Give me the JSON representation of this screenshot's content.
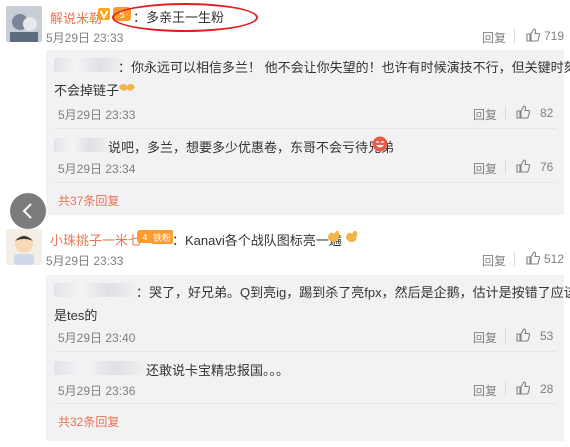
{
  "comments": [
    {
      "username": "解说米勒",
      "text": "：多亲王一生粉",
      "time": "5月29日 23:33",
      "reply_label": "回复",
      "likes": "719",
      "subreplies": [
        {
          "text": "：你永远可以相信多兰！ 他不会让你失望的！也许有时候演技不行，但关键时刻绝",
          "text2": "不会掉链子",
          "time": "5月29日 23:33",
          "reply_label": "回复",
          "likes": "82"
        },
        {
          "text": "说吧，多兰，想要多少优惠卷，东哥不会亏待兄弟",
          "time": "5月29日 23:34",
          "reply_label": "回复",
          "likes": "76"
        }
      ],
      "more_label": "共37条回复"
    },
    {
      "username": "小珠挑子一米七",
      "badge": "铁粉",
      "text": "：Kanavi各个战队图标亮一遍",
      "time": "5月29日 23:33",
      "reply_label": "回复",
      "likes": "512",
      "subreplies": [
        {
          "text": "：哭了，好兄弟。Q到亮ig，踢到杀了亮fpx，然后是企鹅，估计是按错了应该",
          "text2": "是tes的",
          "time": "5月29日 23:40",
          "reply_label": "回复",
          "likes": "53"
        },
        {
          "text": "还敢说卡宝精忠报国。。。",
          "time": "5月29日 23:36",
          "reply_label": "回复",
          "likes": "28"
        }
      ],
      "more_label": "共32条回复"
    }
  ],
  "colors": {
    "username": "#eb7350",
    "annotation_circle": "#e01e1e",
    "subreply_bg": "#f2f2f5"
  }
}
